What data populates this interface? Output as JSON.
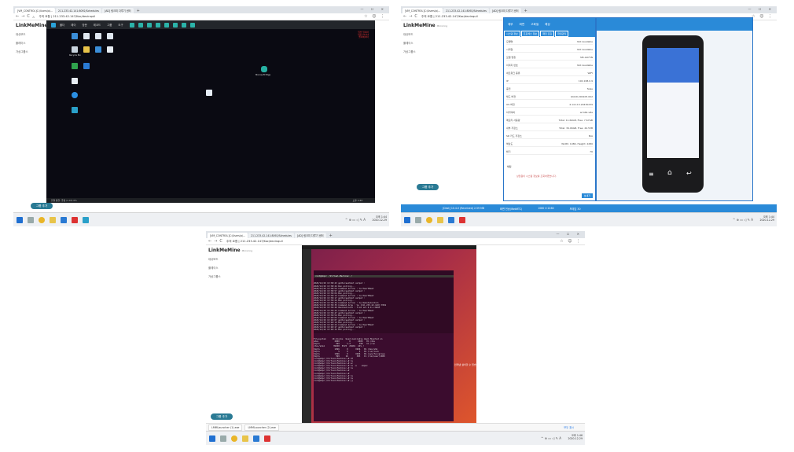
{
  "browser": {
    "tab1": "[VM_CONTROL]C:\\Users\\a\\...",
    "tab2": "211.233.42.141:8092/Schedules",
    "tab3": "[AD] 링크미 다루기 센터",
    "url": "주의 요함 | 211.233.42.147/Koc/devinquil"
  },
  "app": {
    "brand": "LinkMeMine",
    "brand_sub": "Mirroring",
    "side_items": [
      "대쉬보드",
      "플레이스",
      "가상그룹스"
    ],
    "group_add": "그룹 추가"
  },
  "remote": {
    "toolbar": [
      "폴더",
      "레이",
      "방문",
      "레코드",
      "그룹",
      "도구"
    ],
    "icons": [
      "Recycle Bin",
      "Network",
      "Microsoft Edge",
      "Google Chrome",
      "Desktop",
      "LinkMeMine"
    ],
    "red_text": [
      "일부 일어라",
      "서울 23.54",
      "엘리베이터"
    ],
    "taskbar_time": "오후 1:44",
    "taskbar_date": "2020-12-29",
    "status": "연결 품질: 좋음 (1.03) 0%"
  },
  "taskbar": {
    "time": "오후 1:44",
    "date": "2020-12-29",
    "time2": "오후 1:46",
    "date2": "2020-12-29"
  },
  "info": {
    "head": [
      "재부",
      "화면",
      "고화질",
      "해상",
      "도구"
    ],
    "tabs": [
      "시스템 정보",
      "프로세스 정보",
      "패킷 로깅",
      "파일관리",
      "설정"
    ],
    "rows": [
      {
        "k": "모델명",
        "v": "Not Available"
      },
      {
        "k": "시리얼",
        "v": "Not Available"
      },
      {
        "k": "모델 명칭",
        "v": "SM-G975N"
      },
      {
        "k": "이미지 번호",
        "v": "Not Available"
      },
      {
        "k": "네트워크 종류",
        "v": "WIFI"
      },
      {
        "k": "IP",
        "v": "192.168.0.9"
      },
      {
        "k": "충전",
        "v": "false"
      },
      {
        "k": "빌드 버전",
        "v": "QQ1D.200105.002"
      },
      {
        "k": "OS 버전",
        "v": "4.14.113-20430239"
      },
      {
        "k": "아키텍처",
        "v": "arm64-v8a"
      },
      {
        "k": "메모리 사용량",
        "v": "Total: 11.64GB, Free: 7.67GB"
      },
      {
        "k": "내부 저장소",
        "v": "Total: 39.96GB, Free: 44.53B"
      },
      {
        "k": "SD 카드 저장소",
        "v": "N/A"
      },
      {
        "k": "해상도",
        "v": "Width: 1080, Height: 2280"
      },
      {
        "k": "밝기",
        "v": "76"
      }
    ],
    "chat_title": "채팅",
    "chat_msg": "상담원이 시스템 정보를 조회하였습니다.",
    "send": "보내기"
  },
  "status_bar": {
    "left": "[Dest] 10.4.0 (Received) 2.59 MB",
    "mid": "화면 전송(WebRTC)",
    "res": "1080 X 2280",
    "fps": "프레임 30"
  },
  "downloads": {
    "item1": "LMMLauncher (1).exe",
    "item2": "LMMLauncher (2).exe",
    "show_all": "모두 표시"
  },
  "terminal": {
    "title": "root@ubpc: /Virtual-Machine: /",
    "lines": [
      "2020/12/29 13:38:43 getScreenShot output :",
      "2020/12/29 13:38:44 Run polling...",
      "2020/12/29 13:38:54 Command Action : %s HeartBeat",
      "2020/12/29 13:38:57 getScreenShot output :",
      "2020/12/29 13:39:04 Run polling...",
      "2020/12/29 13:39:14 Command Action : %s HeartBeat",
      "2020/12/29 13:39:17 getScreenShot output :",
      "2020/12/29 13:39:24 Run polling...",
      "2020/12/29 13:39:34 Command Action : %s RemoteControl",
      "2020/12/29 13:39:35 Command Args : %s [211.233.42.140]:7001",
      "2020/12/29 13:39:40 HandleClient : from 127.0.0.1:6003",
      "2020/12/29 13:39:44 Command Action : %s HeartBeat",
      "2020/12/29 13:39:47 getScreenShot output :",
      "2020/12/29 13:39:54 Run polling...",
      "2020/12/29 13:40:04 Command Action : %s HeartBeat",
      "2020/12/29 13:40:07 getScreenShot output :",
      "2020/12/29 13:40:14 Run polling...",
      "2020/12/29 13:40:24 Command Action : %s HeartBeat",
      "2020/12/29 13:40:27 getScreenShot output :",
      "2020/12/29 13:40:34 Run polling..."
    ],
    "df_lines": [
      "Filesystem     1K-blocks  Used Available Use% Mounted on",
      "udev             2000        0      2000   0% /dev",
      "tmpfs             399      1.3       398   1% /run",
      "/dev/sda1       39048  8725  28401  24% /",
      "tmpfs            1996      0      1996   0% /dev/shm",
      "tmpfs               5      0         5   0% /run/lock",
      "tmpfs            1996      0      1996   0% /sys/fs/cgroup",
      "tmpfs             399     16       383   1% /run/user/1000",
      "root@ubpc:/Virtual-Machine:~# df",
      "root@ubpc:/Virtual-Machine:~# ls",
      "root@ubpc:/Virtual-Machine:~# sc",
      "root@ubpc:/Virtual-Machine:~# ls -a    skpec",
      "root@ubpc:/Virtual-Machine:~# ls",
      "root@ubpc:/Virtual-Machine:~#",
      "root@ubpc:/Virtual-Machine:~#",
      "root@ubpc:/Virtual-Machine:~# ls",
      "root@ubpc:/Virtual-Machine:~# ls",
      "root@ubpc:/Virtual-Machine:~# []"
    ],
    "notice": "인터넷 설치할 수 있습니다."
  }
}
